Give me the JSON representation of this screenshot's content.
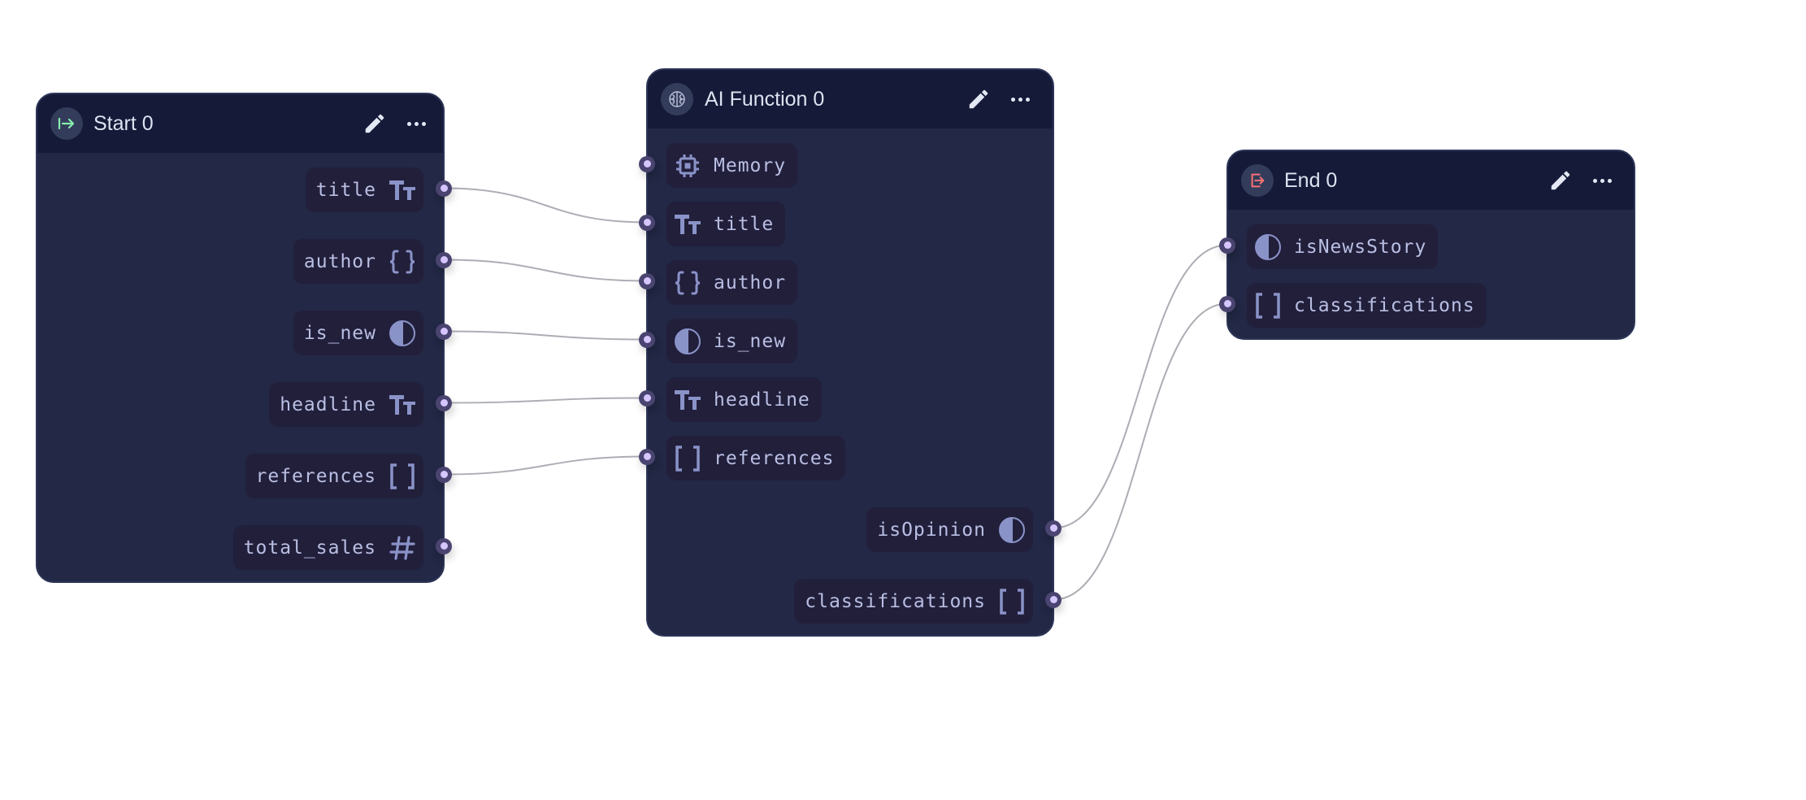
{
  "colors": {
    "node_body": "#222845",
    "node_header": "#141a38",
    "port_bg": "#221f3b",
    "port_text": "#b9bfe3",
    "type_icon": "#8a93c8",
    "handle": "#4a4470",
    "handle_dot": "#d6c6ff",
    "edge": "#adadb5",
    "start_accent": "#86efac",
    "end_accent": "#f87171"
  },
  "nodes": {
    "start": {
      "title": "Start 0",
      "icon": "arrow-right-from-line-icon",
      "outputs": [
        {
          "name": "title",
          "type": "text",
          "icon": "text-type-icon"
        },
        {
          "name": "author",
          "type": "object",
          "icon": "braces-icon"
        },
        {
          "name": "is_new",
          "type": "boolean",
          "icon": "half-circle-icon"
        },
        {
          "name": "headline",
          "type": "text",
          "icon": "text-type-icon"
        },
        {
          "name": "references",
          "type": "array",
          "icon": "brackets-icon"
        },
        {
          "name": "total_sales",
          "type": "number",
          "icon": "hash-icon"
        }
      ]
    },
    "ai_function": {
      "title": "AI Function 0",
      "icon": "brain-icon",
      "inputs": [
        {
          "name": "Memory",
          "type": "memory",
          "icon": "chip-icon"
        },
        {
          "name": "title",
          "type": "text",
          "icon": "text-type-icon"
        },
        {
          "name": "author",
          "type": "object",
          "icon": "braces-icon"
        },
        {
          "name": "is_new",
          "type": "boolean",
          "icon": "half-circle-icon"
        },
        {
          "name": "headline",
          "type": "text",
          "icon": "text-type-icon"
        },
        {
          "name": "references",
          "type": "array",
          "icon": "brackets-icon"
        }
      ],
      "outputs": [
        {
          "name": "isOpinion",
          "type": "boolean",
          "icon": "half-circle-icon"
        },
        {
          "name": "classifications",
          "type": "array",
          "icon": "brackets-icon"
        }
      ]
    },
    "end": {
      "title": "End 0",
      "icon": "exit-icon",
      "inputs": [
        {
          "name": "isNewsStory",
          "type": "boolean",
          "icon": "half-circle-icon"
        },
        {
          "name": "classifications",
          "type": "array",
          "icon": "brackets-icon"
        }
      ]
    }
  },
  "edges": [
    {
      "from": "start.title",
      "to": "ai_function.title"
    },
    {
      "from": "start.author",
      "to": "ai_function.author"
    },
    {
      "from": "start.is_new",
      "to": "ai_function.is_new"
    },
    {
      "from": "start.headline",
      "to": "ai_function.headline"
    },
    {
      "from": "start.references",
      "to": "ai_function.references"
    },
    {
      "from": "ai_function.isOpinion",
      "to": "end.isNewsStory"
    },
    {
      "from": "ai_function.classifications",
      "to": "end.classifications"
    }
  ]
}
